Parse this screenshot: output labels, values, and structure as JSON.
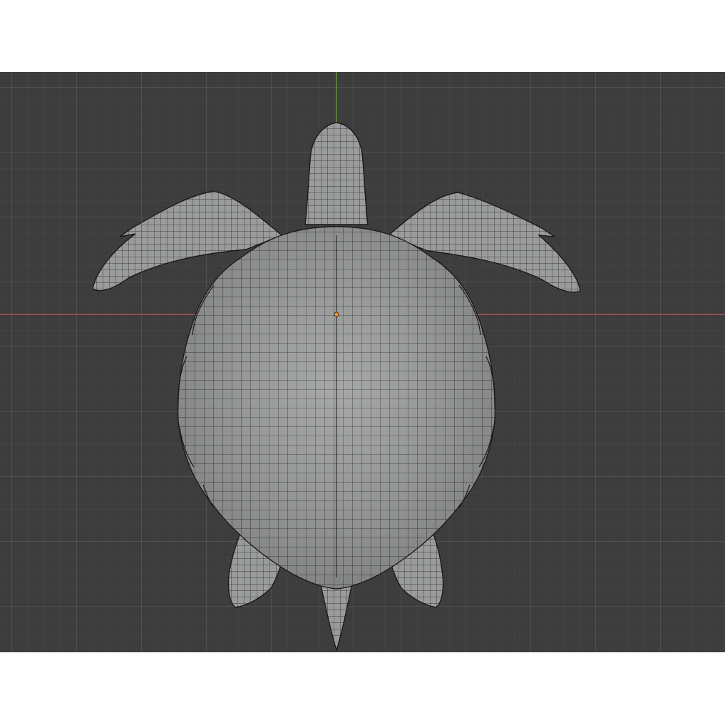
{
  "viewport": {
    "background_color": "#3d3d3d",
    "grid_color": "#4a4a4a",
    "x_axis_color": "#c45a64",
    "y_axis_color": "#6a9a3a",
    "mesh_fill": "#9a9c9c",
    "mesh_wire": "#1e1e1e",
    "origin_color": "#ff8c1a"
  },
  "object": {
    "type": "mesh",
    "shading": "solid-with-wireframe",
    "icon": "sea-turtle-mesh"
  }
}
